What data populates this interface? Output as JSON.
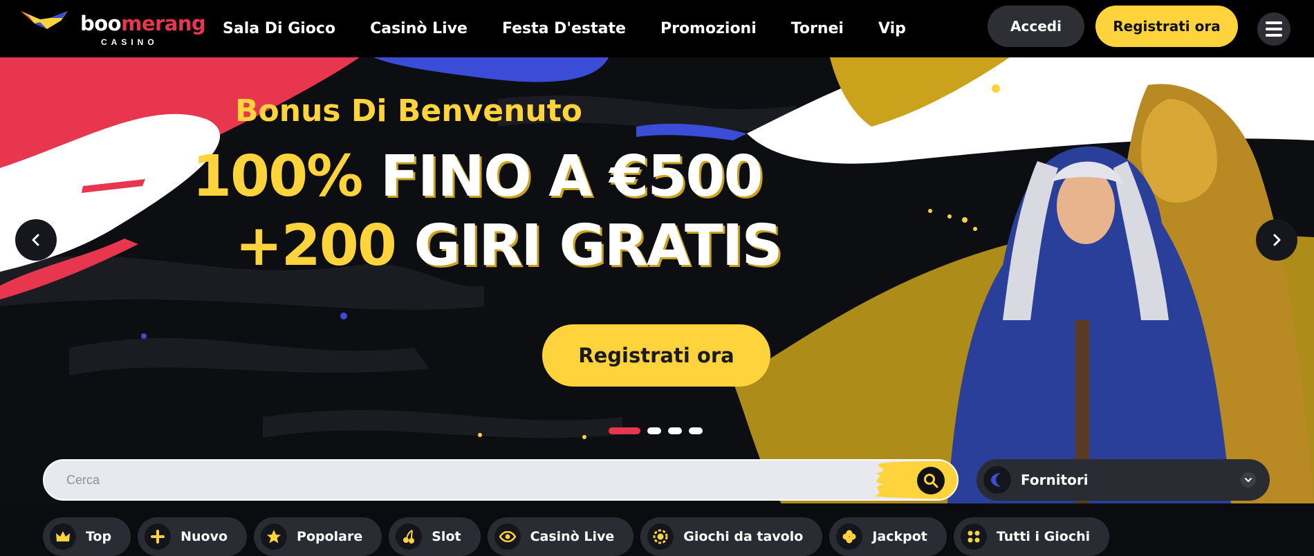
{
  "brand": {
    "name_part1": "boo",
    "name_part2": "merang",
    "tagline": "CASINO",
    "colors": {
      "accent_yellow": "#ffd33c",
      "accent_red": "#e9364f",
      "header_bg": "#000000"
    }
  },
  "nav": {
    "items": [
      "Sala Di Gioco",
      "Casinò Live",
      "Festa D'estate",
      "Promozioni",
      "Tornei",
      "Vip"
    ]
  },
  "header": {
    "login_label": "Accedi",
    "register_label": "Registrati ora",
    "menu_icon": "hamburger-icon"
  },
  "hero": {
    "subtitle": "Bonus Di Benvenuto",
    "line1_highlight": "100%",
    "line1_rest": "FINO A €500",
    "line2_highlight": "+200",
    "line2_rest": "GIRI GRATIS",
    "cta_label": "Registrati ora",
    "slide_count": 4,
    "active_slide": 1
  },
  "search": {
    "placeholder": "Cerca",
    "value": ""
  },
  "providers": {
    "label": "Fornitori"
  },
  "categories": [
    {
      "label": "Top",
      "icon": "crown-icon"
    },
    {
      "label": "Nuovo",
      "icon": "plus-icon"
    },
    {
      "label": "Popolare",
      "icon": "star-icon"
    },
    {
      "label": "Slot",
      "icon": "cherry-icon"
    },
    {
      "label": "Casinò Live",
      "icon": "eye-icon"
    },
    {
      "label": "Giochi da tavolo",
      "icon": "chip-icon"
    },
    {
      "label": "Jackpot",
      "icon": "clover-icon"
    },
    {
      "label": "Tutti i Giochi",
      "icon": "grid-dots-icon"
    }
  ]
}
